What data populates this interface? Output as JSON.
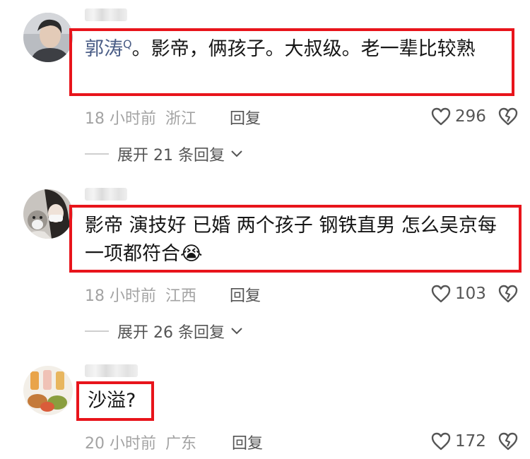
{
  "comments": [
    {
      "mention": "郭涛",
      "mention_sup": "Q",
      "text": "。影帝，俩孩子。大叔级。老一辈比较熟",
      "time": "18 小时前",
      "location": "浙江",
      "reply_label": "回复",
      "likes": "296",
      "expand_label": "展开 21 条回复"
    },
    {
      "text": "影帝 演技好 已婚 两个孩子 钢铁直男 怎么吴京每一项都符合",
      "emoji": "😭",
      "time": "18 小时前",
      "location": "江西",
      "reply_label": "回复",
      "likes": "103",
      "expand_label": "展开 26 条回复"
    },
    {
      "text": "沙溢?",
      "time": "20 小时前",
      "location": "广东",
      "reply_label": "回复",
      "likes": "172"
    }
  ],
  "colors": {
    "highlight_border": "#e8141b",
    "mention": "#4a5d86",
    "meta": "#a3a3a3"
  },
  "icons": {
    "like": "heart-outline-icon",
    "dislike": "broken-heart-icon",
    "expand": "chevron-down-icon"
  }
}
